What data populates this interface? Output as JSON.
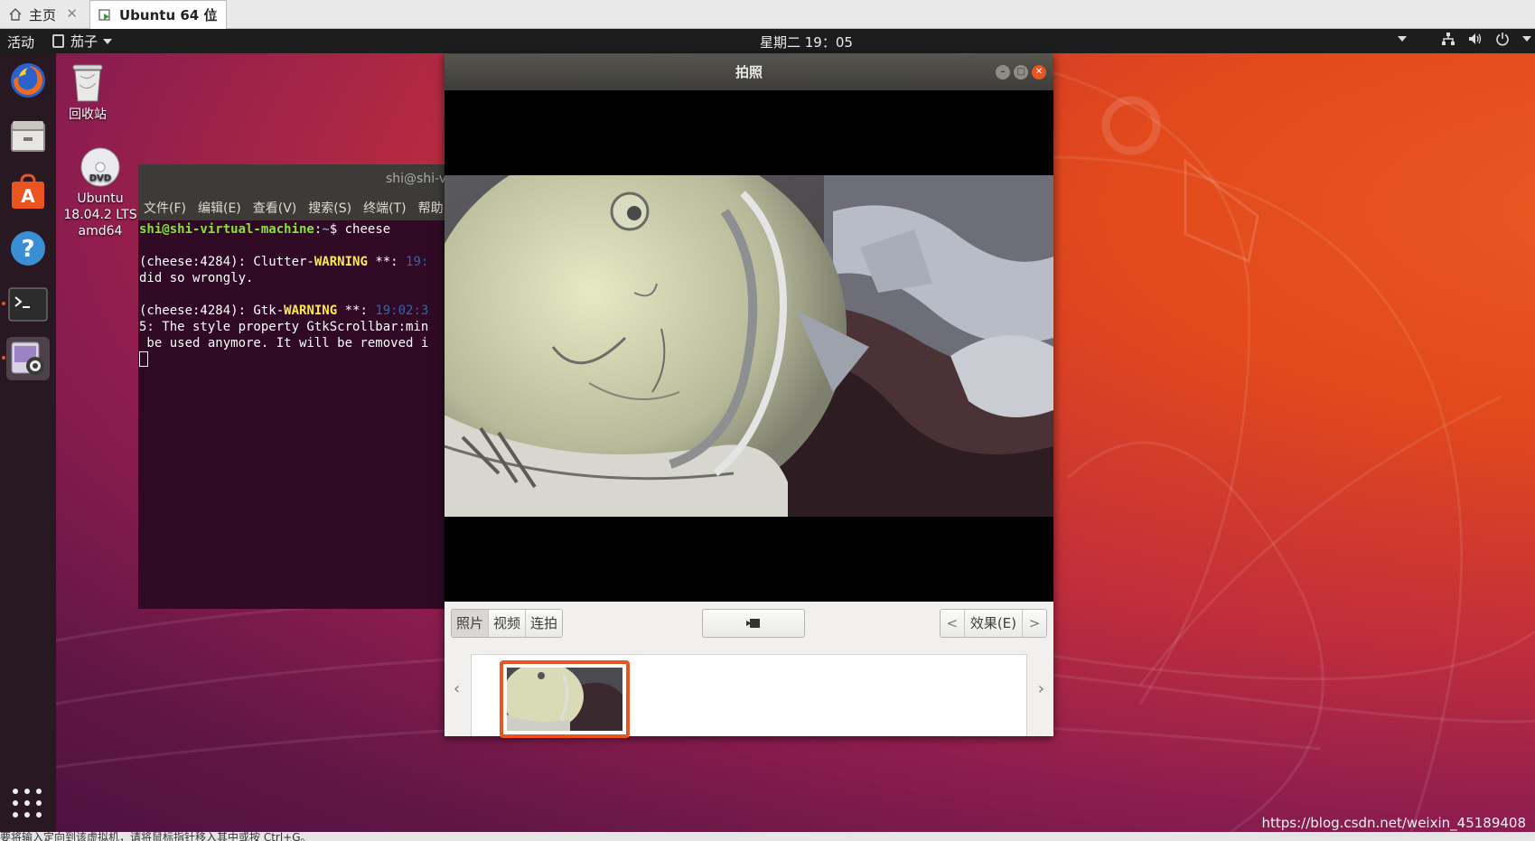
{
  "vmware": {
    "tabs": [
      {
        "label": "主页",
        "icon": "home-icon",
        "active": false
      },
      {
        "label": "Ubuntu 64 位",
        "icon": "vm-icon",
        "active": true
      }
    ],
    "status_text": "要将输入定向到该虚拟机，请将鼠标指针移入其中或按 Ctrl+G。"
  },
  "topbar": {
    "activities": "活动",
    "app_menu": "茄子",
    "clock": "星期二 19：05",
    "tray_icons": [
      "dropdown-arrow-icon",
      "network-icon",
      "volume-icon",
      "power-icon",
      "dropdown-arrow-icon"
    ]
  },
  "dock": {
    "items": [
      {
        "name": "firefox",
        "running": false
      },
      {
        "name": "files",
        "running": false
      },
      {
        "name": "software",
        "running": false
      },
      {
        "name": "help",
        "running": false
      },
      {
        "name": "terminal",
        "running": true
      },
      {
        "name": "cheese",
        "running": true,
        "selected": true
      }
    ],
    "show_apps": "apps-grid-icon"
  },
  "desktop": {
    "trash_label": "回收站",
    "dvd_label_lines": [
      "Ubuntu",
      "18.04.2 LTS",
      "amd64"
    ],
    "dvd_disc_text": "DVD",
    "watermark": "https://blog.csdn.net/weixin_45189408"
  },
  "terminal": {
    "title": "shi@shi-v",
    "menu": [
      "文件(F)",
      "编辑(E)",
      "查看(V)",
      "搜索(S)",
      "终端(T)",
      "帮助"
    ],
    "prompt_user": "shi@shi-virtual-machine",
    "prompt_path": "~",
    "command": "cheese",
    "lines": {
      "l1_pre": "(cheese:4284): Clutter-",
      "l1_warn": "WARNING",
      "l1_mid": " **: ",
      "l1_ts": "19:",
      "l2": "did so wrongly.",
      "l3_pre": "(cheese:4284): Gtk-",
      "l3_warn": "WARNING",
      "l3_mid": " **: ",
      "l3_ts": "19:02:3",
      "l4": "5: The style property GtkScrollbar:min",
      "l5": " be used anymore. It will be removed i"
    }
  },
  "cheese": {
    "title": "拍照",
    "modes": [
      "照片",
      "视频",
      "连拍"
    ],
    "active_mode": "照片",
    "effects_label": "效果(E)",
    "thumbnail_count": 1,
    "colors": {
      "accent": "#e95420"
    }
  }
}
